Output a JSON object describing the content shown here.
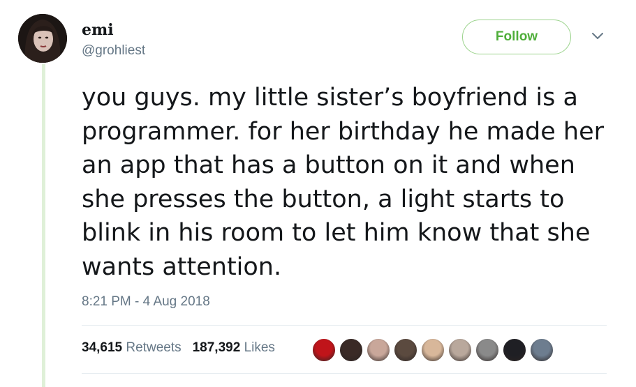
{
  "tweet": {
    "display_name": "emi",
    "username": "@grohliest",
    "follow_label": "Follow",
    "text": "you guys. my little sister’s boyfriend is a programmer. for her birthday he made her an app that has a button on it and when she presses the button, a light starts to blink in his room to let him know that she wants attention.",
    "timestamp": "8:21 PM - 4 Aug 2018",
    "retweets_count": "34,615",
    "retweets_label": "Retweets",
    "likes_count": "187,392",
    "likes_label": "Likes"
  },
  "colors": {
    "accent_green": "#4fae3a",
    "secondary_text": "#657786",
    "thread_line": "#dff0d8"
  },
  "likers": [
    {
      "name": "liker-avatar-1",
      "color": "#c0141a"
    },
    {
      "name": "liker-avatar-2",
      "color": "#3a2a26"
    },
    {
      "name": "liker-avatar-3",
      "color": "#c9a79a"
    },
    {
      "name": "liker-avatar-4",
      "color": "#5b4a3f"
    },
    {
      "name": "liker-avatar-5",
      "color": "#d8b79a"
    },
    {
      "name": "liker-avatar-6",
      "color": "#b9a89c"
    },
    {
      "name": "liker-avatar-7",
      "color": "#8a8a8a"
    },
    {
      "name": "liker-avatar-8",
      "color": "#1f1f24"
    },
    {
      "name": "liker-avatar-9",
      "color": "#6d7d8f"
    }
  ]
}
